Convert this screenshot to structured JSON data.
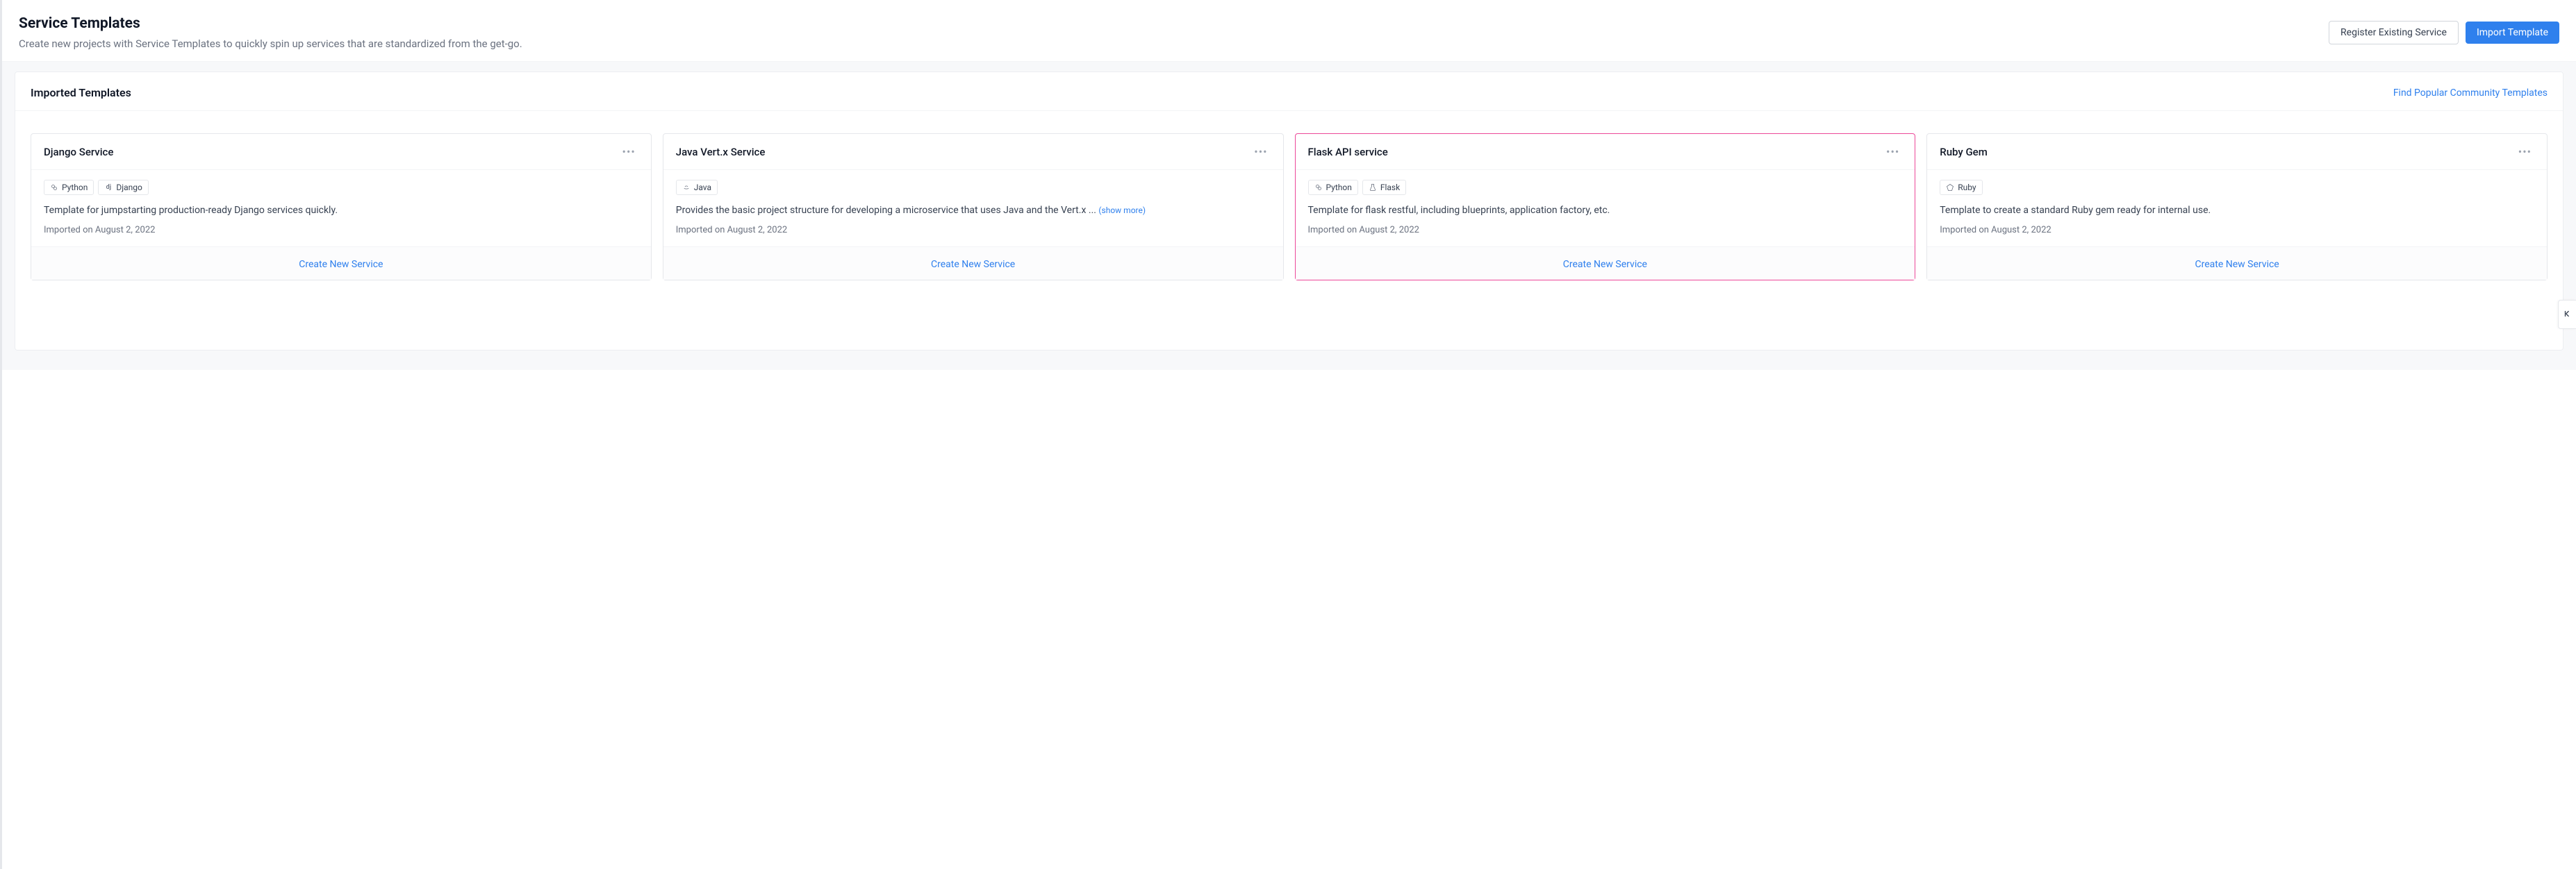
{
  "header": {
    "title": "Service Templates",
    "subtitle": "Create new projects with Service Templates to quickly spin up services that are standardized from the get-go.",
    "register_button": "Register Existing Service",
    "import_button": "Import Template"
  },
  "panel": {
    "title": "Imported Templates",
    "community_link": "Find Popular Community Templates"
  },
  "cards": [
    {
      "title": "Django Service",
      "tags": [
        {
          "icon": "python",
          "label": "Python"
        },
        {
          "icon": "django",
          "label": "Django"
        }
      ],
      "description": "Template for jumpstarting production-ready Django services quickly.",
      "show_more": "",
      "meta": "Imported on August 2, 2022",
      "footer": "Create New Service",
      "highlighted": false
    },
    {
      "title": "Java Vert.x Service",
      "tags": [
        {
          "icon": "java",
          "label": "Java"
        }
      ],
      "description": "Provides the basic project structure for developing a microservice that uses Java and the Vert.x ... ",
      "show_more": "(show more)",
      "meta": "Imported on August 2, 2022",
      "footer": "Create New Service",
      "highlighted": false
    },
    {
      "title": "Flask API service",
      "tags": [
        {
          "icon": "python",
          "label": "Python"
        },
        {
          "icon": "flask",
          "label": "Flask"
        }
      ],
      "description": "Template for flask restful, including blueprints, application factory, etc.",
      "show_more": "",
      "meta": "Imported on August 2, 2022",
      "footer": "Create New Service",
      "highlighted": true
    },
    {
      "title": "Ruby Gem",
      "tags": [
        {
          "icon": "ruby",
          "label": "Ruby"
        }
      ],
      "description": "Template to create a standard Ruby gem ready for internal use.",
      "show_more": "",
      "meta": "Imported on August 2, 2022",
      "footer": "Create New Service",
      "highlighted": false
    }
  ]
}
